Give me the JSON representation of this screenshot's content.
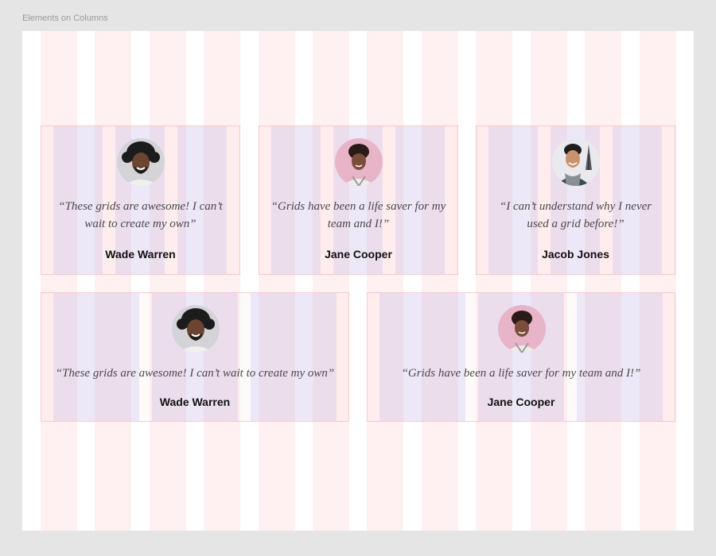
{
  "frame": {
    "label": "Elements on Columns"
  },
  "colors": {
    "column_overlay": "#ffe8e8",
    "inner_column": "#dcdcf7",
    "background": "#e5e5e5"
  },
  "testimonials": [
    {
      "quote": "“These grids are awesome! I can’t wait to create my own”",
      "name": "Wade Warren",
      "avatar": "avatar-wade-warren"
    },
    {
      "quote": "“Grids have been a life saver for my team and I!”",
      "name": "Jane Cooper",
      "avatar": "avatar-jane-cooper"
    },
    {
      "quote": "“I can’t understand why I never used a grid before!”",
      "name": "Jacob Jones",
      "avatar": "avatar-jacob-jones"
    },
    {
      "quote": "“These grids are awesome! I can’t wait to create my own”",
      "name": "Wade Warren",
      "avatar": "avatar-wade-warren"
    },
    {
      "quote": "“Grids have been a life saver for my team and I!”",
      "name": "Jane Cooper",
      "avatar": "avatar-jane-cooper"
    }
  ]
}
